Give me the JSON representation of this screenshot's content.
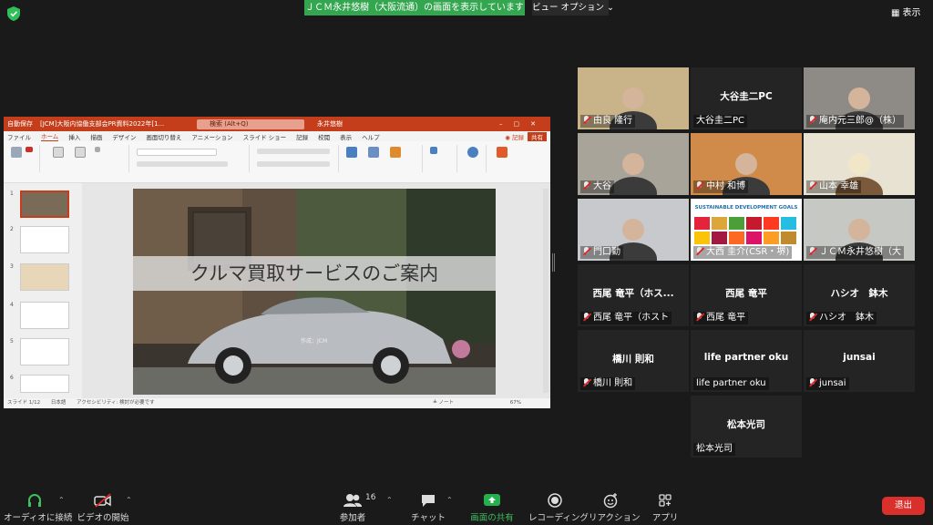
{
  "top": {
    "share_banner": "ＪＣＭ永井悠樹（大阪流通）の画面を表示しています",
    "view_options": "ビュー オプション ⌄",
    "view_button": "表示"
  },
  "ppt": {
    "autosave": "自動保存",
    "title": "[JCM]大阪内協働支部会PR資料2022年[1...",
    "search": "検索 (Alt+Q)",
    "user": "永井悠樹",
    "menu": [
      "ファイル",
      "ホーム",
      "挿入",
      "描画",
      "デザイン",
      "画面切り替え",
      "アニメーション",
      "スライド ショー",
      "記録",
      "校閲",
      "表示",
      "ヘルプ"
    ],
    "record": "◉ 記録",
    "share": "共有",
    "ribbon_groups": [
      "クリップボード",
      "スライド",
      "フォント",
      "段落",
      "図形描画",
      "編集",
      "音声",
      "デザイナー"
    ],
    "ribbon_buttons": [
      "貼り付け",
      "新しいスライド",
      "スライドの再利用",
      "レイアウト",
      "リセット",
      "セクション",
      "図形",
      "配置",
      "クイック スタイル",
      "検索",
      "置換",
      "選択",
      "ディクテーション",
      "デザイン アイデア"
    ],
    "thumb_numbers": [
      "1",
      "2",
      "3",
      "4",
      "5",
      "6"
    ],
    "slide_title": "クルマ買取サービスのご案内",
    "car_label": "作成：JCM",
    "status_slide": "スライド 1/12",
    "status_lang": "日本語",
    "status_access": "アクセシビリティ: 検討が必要です",
    "status_notes": "≜ ノート",
    "status_zoom": "67%"
  },
  "gallery": [
    {
      "name": "由良 隆行",
      "caption": "",
      "muted": true
    },
    {
      "name": "大谷圭二PC",
      "caption": "大谷圭二PC",
      "muted": false
    },
    {
      "name": "庵内元三郎@（株）",
      "caption": "",
      "muted": true
    },
    {
      "name": "大谷",
      "caption": "",
      "muted": true
    },
    {
      "name": "中村 和博",
      "caption": "",
      "muted": true
    },
    {
      "name": "山本 幸雄",
      "caption": "",
      "muted": true
    },
    {
      "name": "門口勤",
      "caption": "",
      "muted": true
    },
    {
      "name": "大西 圭介(CSR・堺)",
      "caption": "",
      "muted": true
    },
    {
      "name": "ＪＣＭ永井悠樹（大",
      "caption": "",
      "muted": true
    },
    {
      "name": "西尾 竜平（ホスト",
      "caption": "西尾 竜平（ホス...",
      "muted": true
    },
    {
      "name": "西尾 竜平",
      "caption": "西尾 竜平",
      "muted": true
    },
    {
      "name": "ハシオ　鉢木",
      "caption": "ハシオ　鉢木",
      "muted": true
    },
    {
      "name": "橋川 則和",
      "caption": "橋川 則和",
      "muted": true
    },
    {
      "name": "life partner oku",
      "caption": "life partner oku",
      "muted": false
    },
    {
      "name": "junsai",
      "caption": "junsai",
      "muted": true
    },
    {
      "name": "松本光司",
      "caption": "松本光司",
      "muted": false
    }
  ],
  "sdg_header": "SUSTAINABLE DEVELOPMENT GOALS",
  "toolbar": {
    "audio": "オーディオに接続",
    "video": "ビデオの開始",
    "participants": "参加者",
    "participants_count": "16",
    "chat": "チャット",
    "share": "画面の共有",
    "record": "レコーディング",
    "reaction": "リアクション",
    "apps": "アプリ",
    "leave": "退出"
  },
  "colors": {
    "ppt_accent": "#c43e1c",
    "share_green": "#35a650",
    "mute_red": "#e02828",
    "speaker_highlight": "#c6d23a",
    "leave_red": "#d9302c"
  }
}
